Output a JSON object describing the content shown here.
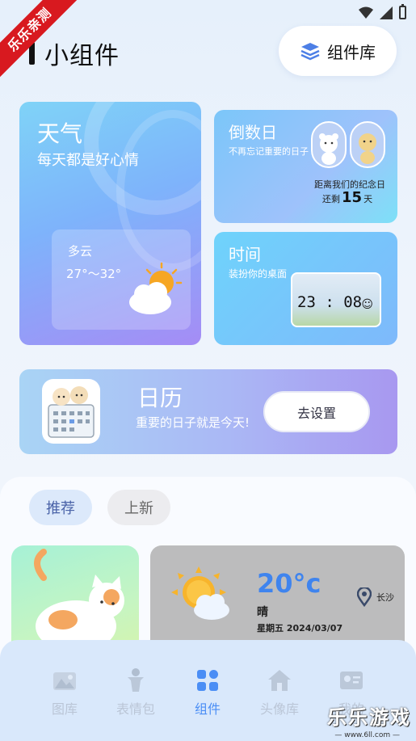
{
  "watermark": {
    "ribbon": "乐乐亲测",
    "brand": "乐乐游戏",
    "url": "— www.6ll.com —"
  },
  "header": {
    "title": "小组件",
    "library_button": "组件库"
  },
  "weather_card": {
    "title": "天气",
    "subtitle": "每天都是好心情",
    "condition": "多云",
    "temperature": "27°～32°"
  },
  "countdown_card": {
    "title": "倒数日",
    "subtitle": "不再忘记重要的日子",
    "line1": "距离我们的纪念日",
    "prefix": "还剩",
    "days": "15",
    "suffix": "天"
  },
  "time_card": {
    "title": "时间",
    "subtitle": "装扮你的桌面",
    "clock": "23 : 08"
  },
  "calendar_card": {
    "title": "日历",
    "subtitle": "重要的日子就是今天!",
    "button": "去设置"
  },
  "filters": [
    {
      "label": "推荐",
      "active": true
    },
    {
      "label": "上新",
      "active": false
    }
  ],
  "weather_preview": {
    "temperature": "20°c",
    "condition": "晴",
    "date": "星期五 2024/03/07",
    "city": "长沙"
  },
  "tabs": [
    {
      "label": "图库",
      "icon": "mountain-image-icon",
      "active": false
    },
    {
      "label": "表情包",
      "icon": "person-icon",
      "active": false
    },
    {
      "label": "组件",
      "icon": "widget-grid-icon",
      "active": true
    },
    {
      "label": "头像库",
      "icon": "house-icon",
      "active": false
    },
    {
      "label": "我的",
      "icon": "profile-card-icon",
      "active": false
    }
  ],
  "colors": {
    "accent": "#4b8ef5",
    "tabbar_bg": "#d9e8fb",
    "temp_blue": "#3f84ee"
  }
}
